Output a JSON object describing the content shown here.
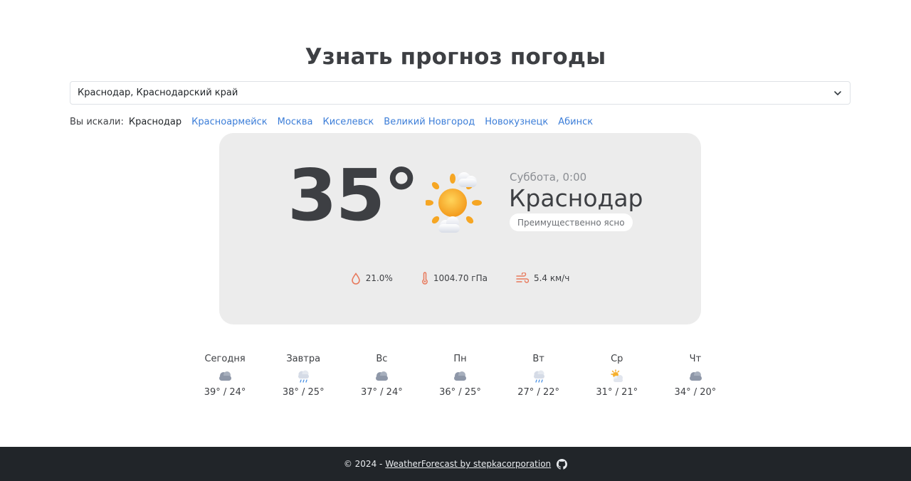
{
  "header": {
    "title": "Узнать прогноз погоды"
  },
  "search": {
    "selected_value": "Краснодар, Краснодарский край"
  },
  "history": {
    "label": "Вы искали:",
    "current": "Краснодар",
    "links": [
      "Красноармейск",
      "Москва",
      "Киселевск",
      "Великий Новгород",
      "Новокузнецк",
      "Абинск"
    ]
  },
  "current": {
    "temperature": "35°",
    "day_time": "Суббота, 0:00",
    "city": "Краснодар",
    "condition": "Преимущественно ясно",
    "icon": "sun-with-clouds-icon",
    "humidity": "21.0%",
    "pressure": "1004.70 гПа",
    "wind": "5.4 км/ч"
  },
  "forecast": [
    {
      "day": "Сегодня",
      "range": "39° / 24°",
      "icon": "cloudy-icon"
    },
    {
      "day": "Завтра",
      "range": "38° / 25°",
      "icon": "rain-icon"
    },
    {
      "day": "Вс",
      "range": "37° / 24°",
      "icon": "cloudy-icon"
    },
    {
      "day": "Пн",
      "range": "36° / 25°",
      "icon": "cloudy-icon"
    },
    {
      "day": "Вт",
      "range": "27° / 22°",
      "icon": "rain-icon"
    },
    {
      "day": "Ср",
      "range": "31° / 21°",
      "icon": "partly-sunny-icon"
    },
    {
      "day": "Чт",
      "range": "34° / 20°",
      "icon": "cloudy-icon"
    }
  ],
  "footer": {
    "copyright": "© 2024 -",
    "link_text": "WeatherForecast by stepkacorporation"
  },
  "colors": {
    "accent_link": "#3b7dd8",
    "card_bg": "#ececec",
    "footer_bg": "#212529",
    "stat_icon": "#e87a5d"
  }
}
